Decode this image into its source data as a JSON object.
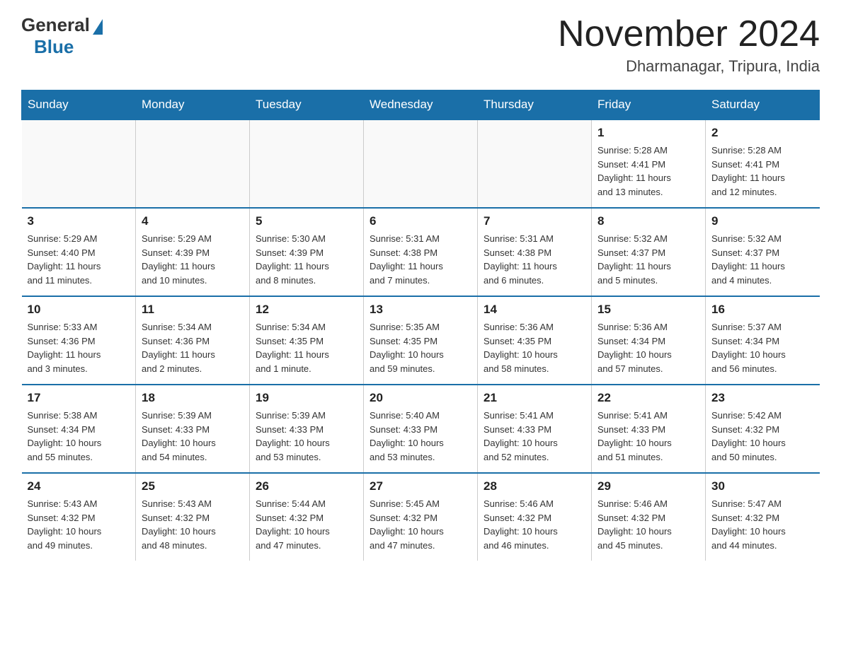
{
  "header": {
    "logo_general": "General",
    "logo_blue": "Blue",
    "month_year": "November 2024",
    "location": "Dharmanagar, Tripura, India"
  },
  "weekdays": [
    "Sunday",
    "Monday",
    "Tuesday",
    "Wednesday",
    "Thursday",
    "Friday",
    "Saturday"
  ],
  "weeks": [
    [
      {
        "day": "",
        "info": ""
      },
      {
        "day": "",
        "info": ""
      },
      {
        "day": "",
        "info": ""
      },
      {
        "day": "",
        "info": ""
      },
      {
        "day": "",
        "info": ""
      },
      {
        "day": "1",
        "info": "Sunrise: 5:28 AM\nSunset: 4:41 PM\nDaylight: 11 hours\nand 13 minutes."
      },
      {
        "day": "2",
        "info": "Sunrise: 5:28 AM\nSunset: 4:41 PM\nDaylight: 11 hours\nand 12 minutes."
      }
    ],
    [
      {
        "day": "3",
        "info": "Sunrise: 5:29 AM\nSunset: 4:40 PM\nDaylight: 11 hours\nand 11 minutes."
      },
      {
        "day": "4",
        "info": "Sunrise: 5:29 AM\nSunset: 4:39 PM\nDaylight: 11 hours\nand 10 minutes."
      },
      {
        "day": "5",
        "info": "Sunrise: 5:30 AM\nSunset: 4:39 PM\nDaylight: 11 hours\nand 8 minutes."
      },
      {
        "day": "6",
        "info": "Sunrise: 5:31 AM\nSunset: 4:38 PM\nDaylight: 11 hours\nand 7 minutes."
      },
      {
        "day": "7",
        "info": "Sunrise: 5:31 AM\nSunset: 4:38 PM\nDaylight: 11 hours\nand 6 minutes."
      },
      {
        "day": "8",
        "info": "Sunrise: 5:32 AM\nSunset: 4:37 PM\nDaylight: 11 hours\nand 5 minutes."
      },
      {
        "day": "9",
        "info": "Sunrise: 5:32 AM\nSunset: 4:37 PM\nDaylight: 11 hours\nand 4 minutes."
      }
    ],
    [
      {
        "day": "10",
        "info": "Sunrise: 5:33 AM\nSunset: 4:36 PM\nDaylight: 11 hours\nand 3 minutes."
      },
      {
        "day": "11",
        "info": "Sunrise: 5:34 AM\nSunset: 4:36 PM\nDaylight: 11 hours\nand 2 minutes."
      },
      {
        "day": "12",
        "info": "Sunrise: 5:34 AM\nSunset: 4:35 PM\nDaylight: 11 hours\nand 1 minute."
      },
      {
        "day": "13",
        "info": "Sunrise: 5:35 AM\nSunset: 4:35 PM\nDaylight: 10 hours\nand 59 minutes."
      },
      {
        "day": "14",
        "info": "Sunrise: 5:36 AM\nSunset: 4:35 PM\nDaylight: 10 hours\nand 58 minutes."
      },
      {
        "day": "15",
        "info": "Sunrise: 5:36 AM\nSunset: 4:34 PM\nDaylight: 10 hours\nand 57 minutes."
      },
      {
        "day": "16",
        "info": "Sunrise: 5:37 AM\nSunset: 4:34 PM\nDaylight: 10 hours\nand 56 minutes."
      }
    ],
    [
      {
        "day": "17",
        "info": "Sunrise: 5:38 AM\nSunset: 4:34 PM\nDaylight: 10 hours\nand 55 minutes."
      },
      {
        "day": "18",
        "info": "Sunrise: 5:39 AM\nSunset: 4:33 PM\nDaylight: 10 hours\nand 54 minutes."
      },
      {
        "day": "19",
        "info": "Sunrise: 5:39 AM\nSunset: 4:33 PM\nDaylight: 10 hours\nand 53 minutes."
      },
      {
        "day": "20",
        "info": "Sunrise: 5:40 AM\nSunset: 4:33 PM\nDaylight: 10 hours\nand 53 minutes."
      },
      {
        "day": "21",
        "info": "Sunrise: 5:41 AM\nSunset: 4:33 PM\nDaylight: 10 hours\nand 52 minutes."
      },
      {
        "day": "22",
        "info": "Sunrise: 5:41 AM\nSunset: 4:33 PM\nDaylight: 10 hours\nand 51 minutes."
      },
      {
        "day": "23",
        "info": "Sunrise: 5:42 AM\nSunset: 4:32 PM\nDaylight: 10 hours\nand 50 minutes."
      }
    ],
    [
      {
        "day": "24",
        "info": "Sunrise: 5:43 AM\nSunset: 4:32 PM\nDaylight: 10 hours\nand 49 minutes."
      },
      {
        "day": "25",
        "info": "Sunrise: 5:43 AM\nSunset: 4:32 PM\nDaylight: 10 hours\nand 48 minutes."
      },
      {
        "day": "26",
        "info": "Sunrise: 5:44 AM\nSunset: 4:32 PM\nDaylight: 10 hours\nand 47 minutes."
      },
      {
        "day": "27",
        "info": "Sunrise: 5:45 AM\nSunset: 4:32 PM\nDaylight: 10 hours\nand 47 minutes."
      },
      {
        "day": "28",
        "info": "Sunrise: 5:46 AM\nSunset: 4:32 PM\nDaylight: 10 hours\nand 46 minutes."
      },
      {
        "day": "29",
        "info": "Sunrise: 5:46 AM\nSunset: 4:32 PM\nDaylight: 10 hours\nand 45 minutes."
      },
      {
        "day": "30",
        "info": "Sunrise: 5:47 AM\nSunset: 4:32 PM\nDaylight: 10 hours\nand 44 minutes."
      }
    ]
  ]
}
